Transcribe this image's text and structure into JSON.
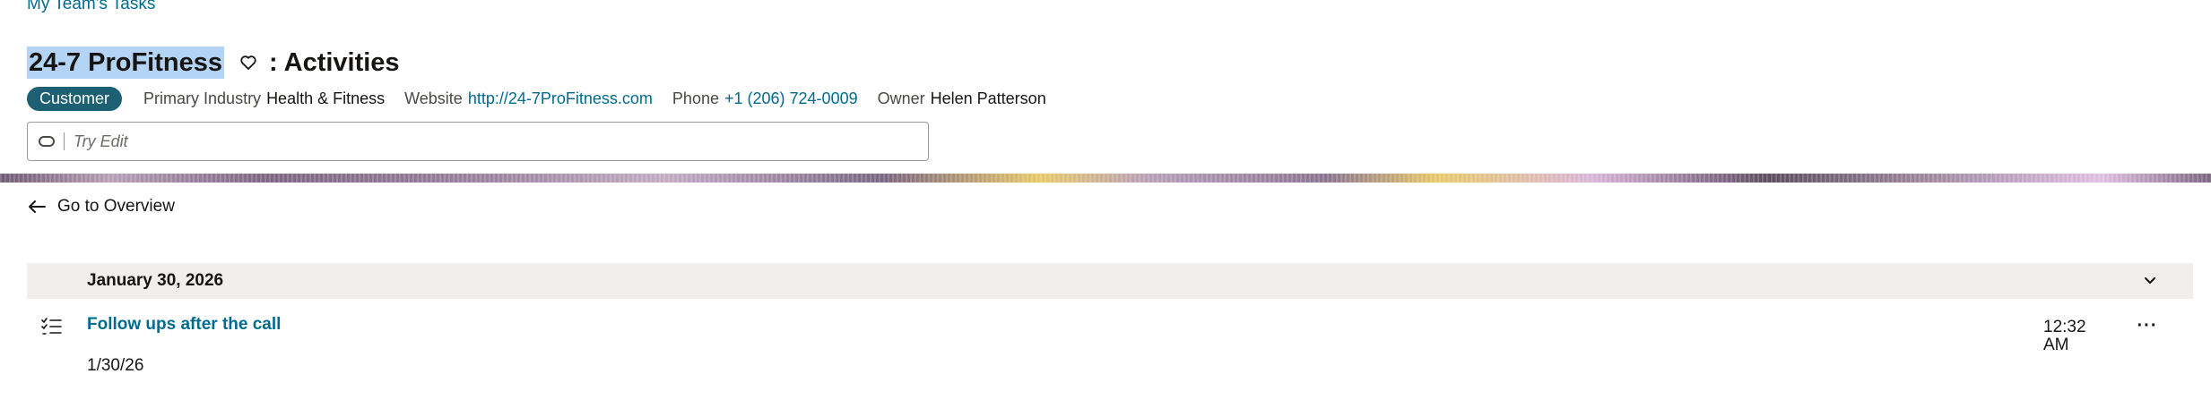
{
  "breadcrumb": {
    "label": "My Team's Tasks"
  },
  "header": {
    "account_name": "24-7 ProFitness",
    "title_suffix": ": Activities",
    "favorite_icon": "heart-outline-icon"
  },
  "meta": {
    "badge": "Customer",
    "industry_label": "Primary Industry",
    "industry_value": "Health & Fitness",
    "website_label": "Website",
    "website_value": "http://24-7ProFitness.com",
    "phone_label": "Phone",
    "phone_value": "+1 (206) 724-0009",
    "owner_label": "Owner",
    "owner_value": "Helen Patterson"
  },
  "try_edit": {
    "placeholder": "Try Edit",
    "icon": "ai-pill-icon"
  },
  "nav": {
    "back_label": "Go to Overview",
    "back_icon": "arrow-left-icon"
  },
  "activities": {
    "date_header": "January 30, 2026",
    "items": [
      {
        "title": "Follow ups after the call",
        "date": "1/30/26",
        "time": "12:32 AM",
        "icon": "task-checklist-icon",
        "more": "···"
      }
    ]
  },
  "colors": {
    "link": "#006b8f",
    "badge_bg": "#1d5f73",
    "selection_highlight": "#b3d4f5",
    "date_bar_bg": "#f1efed"
  }
}
